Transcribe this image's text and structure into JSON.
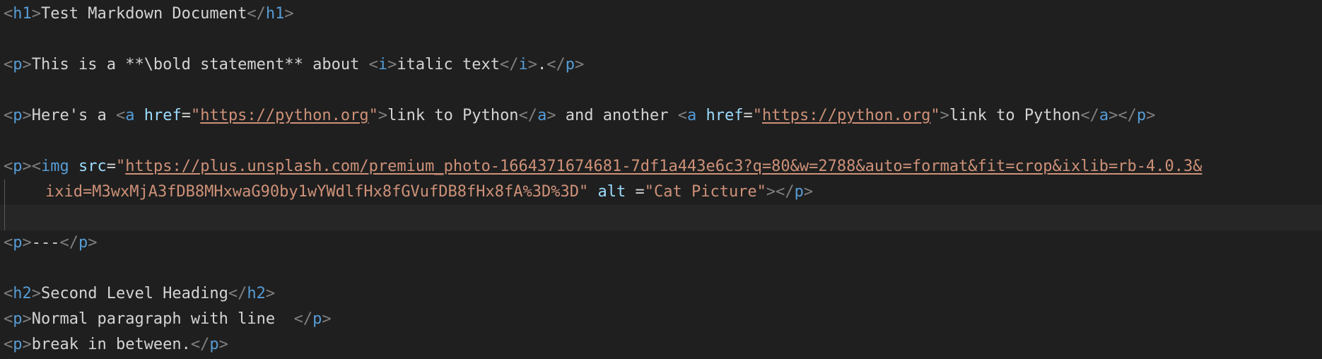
{
  "editor": {
    "lines": [
      {
        "kind": "code",
        "tokens": [
          {
            "t": "<",
            "c": "tag"
          },
          {
            "t": "h1",
            "c": "tn"
          },
          {
            "t": ">",
            "c": "tag"
          },
          {
            "t": "Test Markdown Document",
            "c": "txt"
          },
          {
            "t": "</",
            "c": "tag"
          },
          {
            "t": "h1",
            "c": "tn"
          },
          {
            "t": ">",
            "c": "tag"
          }
        ]
      },
      {
        "kind": "blank",
        "tokens": []
      },
      {
        "kind": "code",
        "tokens": [
          {
            "t": "<",
            "c": "tag"
          },
          {
            "t": "p",
            "c": "tn"
          },
          {
            "t": ">",
            "c": "tag"
          },
          {
            "t": "This is a **\\bold statement** about ",
            "c": "txt"
          },
          {
            "t": "<",
            "c": "tag"
          },
          {
            "t": "i",
            "c": "tn"
          },
          {
            "t": ">",
            "c": "tag"
          },
          {
            "t": "italic text",
            "c": "txt"
          },
          {
            "t": "</",
            "c": "tag"
          },
          {
            "t": "i",
            "c": "tn"
          },
          {
            "t": ">",
            "c": "tag"
          },
          {
            "t": ".",
            "c": "txt"
          },
          {
            "t": "</",
            "c": "tag"
          },
          {
            "t": "p",
            "c": "tn"
          },
          {
            "t": ">",
            "c": "tag"
          }
        ]
      },
      {
        "kind": "blank",
        "tokens": []
      },
      {
        "kind": "code",
        "tokens": [
          {
            "t": "<",
            "c": "tag"
          },
          {
            "t": "p",
            "c": "tn"
          },
          {
            "t": ">",
            "c": "tag"
          },
          {
            "t": "Here's a ",
            "c": "txt"
          },
          {
            "t": "<",
            "c": "tag"
          },
          {
            "t": "a",
            "c": "tn"
          },
          {
            "t": " ",
            "c": "txt"
          },
          {
            "t": "href",
            "c": "an"
          },
          {
            "t": "=",
            "c": "eq"
          },
          {
            "t": "\"",
            "c": "str"
          },
          {
            "t": "https://python.org",
            "c": "url",
            "link": true
          },
          {
            "t": "\"",
            "c": "str"
          },
          {
            "t": ">",
            "c": "tag"
          },
          {
            "t": "link to Python",
            "c": "txt"
          },
          {
            "t": "</",
            "c": "tag"
          },
          {
            "t": "a",
            "c": "tn"
          },
          {
            "t": ">",
            "c": "tag"
          },
          {
            "t": " and another ",
            "c": "txt"
          },
          {
            "t": "<",
            "c": "tag"
          },
          {
            "t": "a",
            "c": "tn"
          },
          {
            "t": " ",
            "c": "txt"
          },
          {
            "t": "href",
            "c": "an"
          },
          {
            "t": "=",
            "c": "eq"
          },
          {
            "t": "\"",
            "c": "str"
          },
          {
            "t": "https://python.org",
            "c": "url",
            "link": true
          },
          {
            "t": "\"",
            "c": "str"
          },
          {
            "t": ">",
            "c": "tag"
          },
          {
            "t": "link to Python",
            "c": "txt"
          },
          {
            "t": "</",
            "c": "tag"
          },
          {
            "t": "a",
            "c": "tn"
          },
          {
            "t": ">",
            "c": "tag"
          },
          {
            "t": "</",
            "c": "tag"
          },
          {
            "t": "p",
            "c": "tn"
          },
          {
            "t": ">",
            "c": "tag"
          }
        ]
      },
      {
        "kind": "blank",
        "tokens": []
      },
      {
        "kind": "code",
        "tokens": [
          {
            "t": "<",
            "c": "tag"
          },
          {
            "t": "p",
            "c": "tn"
          },
          {
            "t": ">",
            "c": "tag"
          },
          {
            "t": "<",
            "c": "tag"
          },
          {
            "t": "img",
            "c": "tn"
          },
          {
            "t": " ",
            "c": "txt"
          },
          {
            "t": "src",
            "c": "an"
          },
          {
            "t": "=",
            "c": "eq"
          },
          {
            "t": "\"",
            "c": "str"
          },
          {
            "t": "https://plus.unsplash.com/premium_photo-1664371674681-7df1a443e6c3?q=80&w=2788&auto=format&fit=crop&ixlib=rb-4.0.3&",
            "c": "url",
            "link": true
          }
        ]
      },
      {
        "kind": "wrap",
        "tokens": [
          {
            "t": "ixid=M3wxMjA3fDB8MHxwaG90by1wYWdlfHx8fGVufDB8fHx8fA%3D%3D",
            "c": "str"
          },
          {
            "t": "\"",
            "c": "str"
          },
          {
            "t": " ",
            "c": "txt"
          },
          {
            "t": "alt",
            "c": "an"
          },
          {
            "t": " =",
            "c": "eq"
          },
          {
            "t": "\"Cat Picture\"",
            "c": "str"
          },
          {
            "t": ">",
            "c": "tag"
          },
          {
            "t": "</",
            "c": "tag"
          },
          {
            "t": "p",
            "c": "tn"
          },
          {
            "t": ">",
            "c": "tag"
          }
        ]
      },
      {
        "kind": "active",
        "tokens": []
      },
      {
        "kind": "code",
        "tokens": [
          {
            "t": "<",
            "c": "tag"
          },
          {
            "t": "p",
            "c": "tn"
          },
          {
            "t": ">",
            "c": "tag"
          },
          {
            "t": "---",
            "c": "txt"
          },
          {
            "t": "</",
            "c": "tag"
          },
          {
            "t": "p",
            "c": "tn"
          },
          {
            "t": ">",
            "c": "tag"
          }
        ]
      },
      {
        "kind": "blank",
        "tokens": []
      },
      {
        "kind": "code",
        "tokens": [
          {
            "t": "<",
            "c": "tag"
          },
          {
            "t": "h2",
            "c": "tn"
          },
          {
            "t": ">",
            "c": "tag"
          },
          {
            "t": "Second Level Heading",
            "c": "txt"
          },
          {
            "t": "</",
            "c": "tag"
          },
          {
            "t": "h2",
            "c": "tn"
          },
          {
            "t": ">",
            "c": "tag"
          }
        ]
      },
      {
        "kind": "code",
        "tokens": [
          {
            "t": "<",
            "c": "tag"
          },
          {
            "t": "p",
            "c": "tn"
          },
          {
            "t": ">",
            "c": "tag"
          },
          {
            "t": "Normal paragraph with line  ",
            "c": "txt"
          },
          {
            "t": "</",
            "c": "tag"
          },
          {
            "t": "p",
            "c": "tn"
          },
          {
            "t": ">",
            "c": "tag"
          }
        ]
      },
      {
        "kind": "code",
        "tokens": [
          {
            "t": "<",
            "c": "tag"
          },
          {
            "t": "p",
            "c": "tn"
          },
          {
            "t": ">",
            "c": "tag"
          },
          {
            "t": "break in between.",
            "c": "txt"
          },
          {
            "t": "</",
            "c": "tag"
          },
          {
            "t": "p",
            "c": "tn"
          },
          {
            "t": ">",
            "c": "tag"
          }
        ]
      }
    ]
  },
  "colors": {
    "background": "#1f1f1f",
    "tag_bracket": "#808080",
    "tag_name": "#569cd6",
    "attribute": "#9cdcfe",
    "string": "#ce9178",
    "text": "#d4d4d4"
  }
}
